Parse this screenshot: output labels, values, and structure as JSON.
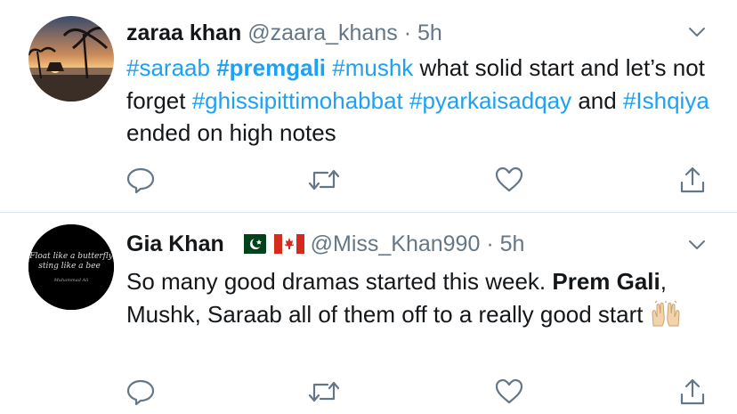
{
  "tweets": [
    {
      "name": "zaraa khan",
      "handle": "@zaara_khans",
      "sep": "·",
      "time": "5h",
      "body": [
        {
          "t": "#saraab",
          "k": "ht"
        },
        {
          "t": " ",
          "k": ""
        },
        {
          "t": "#premgali",
          "k": "htb"
        },
        {
          "t": " ",
          "k": ""
        },
        {
          "t": "#mushk",
          "k": "ht"
        },
        {
          "t": " what solid start and let’s not forget ",
          "k": ""
        },
        {
          "t": "#ghissipittimohabbat",
          "k": "ht"
        },
        {
          "t": " ",
          "k": ""
        },
        {
          "t": "#pyarkaisadqay",
          "k": "ht"
        },
        {
          "t": " and ",
          "k": ""
        },
        {
          "t": "#Ishqiya",
          "k": "ht"
        },
        {
          "t": " ended on high notes",
          "k": ""
        }
      ]
    },
    {
      "name": "Gia Khan",
      "handle": "@Miss_Khan990",
      "sep": "·",
      "time": "5h",
      "avatar_text": {
        "line1": "Float like a butterfly",
        "line2": "sting like a bee",
        "line3": "Muhammad Ali"
      },
      "body": [
        {
          "t": "So many good dramas started this week. ",
          "k": ""
        },
        {
          "t": "Prem Gali",
          "k": "b"
        },
        {
          "t": ", Mushk, Saraab all of them off to a really good start ",
          "k": ""
        }
      ]
    }
  ],
  "colors": {
    "hashtag": "#1da1f2",
    "meta": "#657786",
    "icon": "#657786",
    "divider": "#e1e8ed"
  },
  "icons": [
    "reply-icon",
    "retweet-icon",
    "like-icon",
    "share-icon",
    "chevron-down-icon",
    "raised-hands-emoji",
    "pakistan-flag",
    "canada-flag"
  ]
}
